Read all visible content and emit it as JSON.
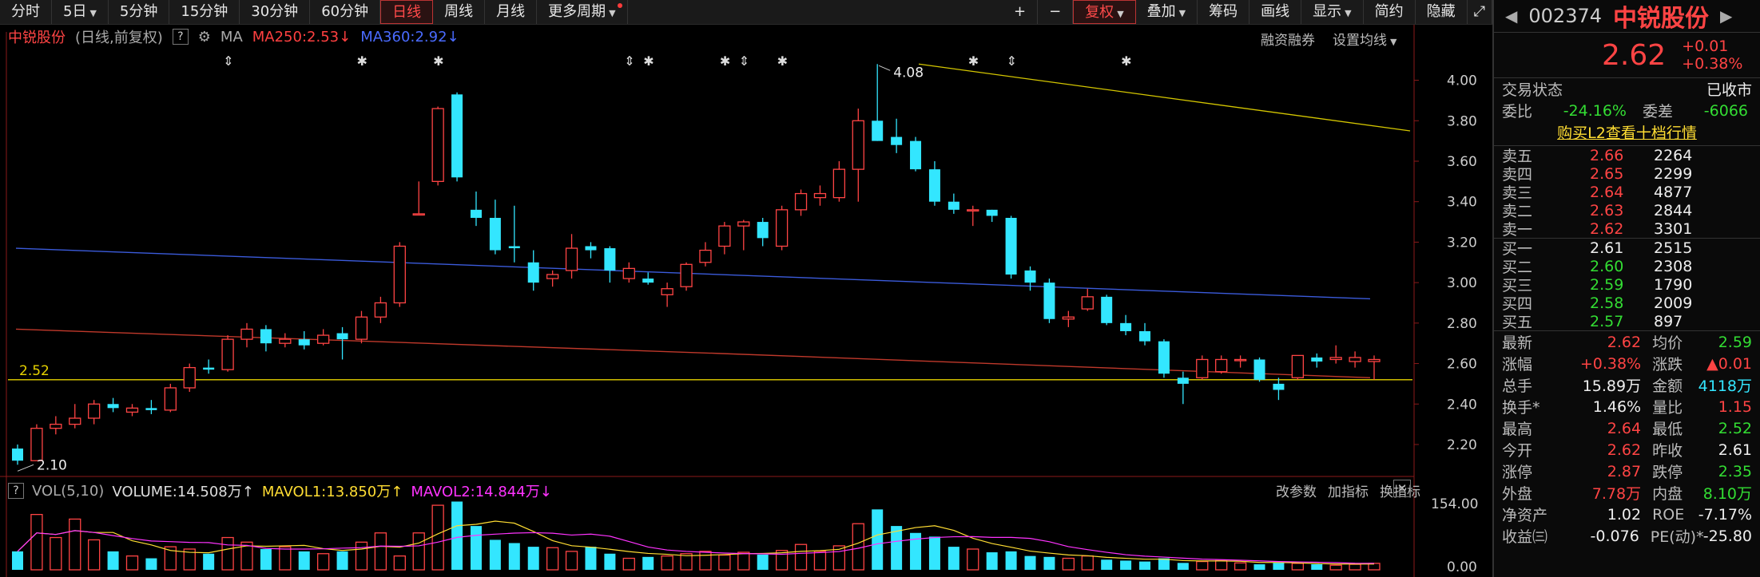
{
  "toolbar": {
    "periods": [
      "分时",
      "5日",
      "5分钟",
      "15分钟",
      "30分钟",
      "60分钟",
      "日线",
      "周线",
      "月线",
      "更多周期"
    ],
    "active": "日线",
    "right": [
      "+",
      "−",
      "复权",
      "叠加",
      "筹码",
      "画线",
      "显示",
      "简约",
      "隐藏"
    ]
  },
  "header": {
    "stock_name": "中锐股份",
    "subtitle": "(日线,前复权)",
    "ma_label": "MA",
    "ma250": "MA250:2.53↓",
    "ma360": "MA360:2.92↓",
    "margin_btn": "融资融券",
    "set_ma_btn": "设置均线"
  },
  "price_axis": {
    "ticks": [
      "4.00",
      "3.80",
      "3.60",
      "3.40",
      "3.20",
      "3.00",
      "2.80",
      "2.60",
      "2.40",
      "2.20"
    ],
    "high_label": "4.08",
    "low_label": "2.10",
    "level_label": "2.52"
  },
  "volume": {
    "label": "VOL(5,10)",
    "volume": "VOLUME:14.508万↑",
    "mavol1": "MAVOL1:13.850万↑",
    "mavol2": "MAVOL2:14.844万↓",
    "tools": [
      "改参数",
      "加指标",
      "换指标"
    ],
    "ticks": [
      "154.00",
      "0.00"
    ]
  },
  "colors": {
    "up": "#ff4444",
    "down": "#33e6ff",
    "ma360": "#3b5bdb",
    "ma250": "#c0392b",
    "trend": "#d4c600",
    "level": "#e6d200"
  },
  "candles": [
    [
      2.18,
      2.12,
      2.2,
      2.1
    ],
    [
      2.12,
      2.28,
      2.3,
      2.12
    ],
    [
      2.28,
      2.3,
      2.34,
      2.25
    ],
    [
      2.3,
      2.33,
      2.4,
      2.28
    ],
    [
      2.33,
      2.4,
      2.42,
      2.3
    ],
    [
      2.4,
      2.38,
      2.43,
      2.36
    ],
    [
      2.36,
      2.38,
      2.4,
      2.34
    ],
    [
      2.38,
      2.37,
      2.42,
      2.35
    ],
    [
      2.37,
      2.48,
      2.5,
      2.36
    ],
    [
      2.48,
      2.58,
      2.6,
      2.46
    ],
    [
      2.58,
      2.57,
      2.62,
      2.55
    ],
    [
      2.57,
      2.72,
      2.74,
      2.56
    ],
    [
      2.72,
      2.77,
      2.8,
      2.68
    ],
    [
      2.77,
      2.7,
      2.79,
      2.66
    ],
    [
      2.7,
      2.72,
      2.75,
      2.68
    ],
    [
      2.72,
      2.69,
      2.76,
      2.67
    ],
    [
      2.7,
      2.74,
      2.77,
      2.69
    ],
    [
      2.75,
      2.72,
      2.78,
      2.62
    ],
    [
      2.72,
      2.83,
      2.86,
      2.7
    ],
    [
      2.83,
      2.9,
      2.93,
      2.8
    ],
    [
      2.9,
      3.18,
      3.2,
      2.88
    ],
    [
      3.34,
      3.34,
      3.5,
      3.34
    ],
    [
      3.5,
      3.86,
      3.87,
      3.48
    ],
    [
      3.93,
      3.52,
      3.94,
      3.5
    ],
    [
      3.36,
      3.32,
      3.45,
      3.28
    ],
    [
      3.32,
      3.16,
      3.41,
      3.14
    ],
    [
      3.18,
      3.17,
      3.38,
      3.1
    ],
    [
      3.1,
      3.0,
      3.16,
      2.96
    ],
    [
      3.02,
      3.04,
      3.06,
      2.98
    ],
    [
      3.06,
      3.17,
      3.24,
      3.02
    ],
    [
      3.18,
      3.16,
      3.2,
      3.12
    ],
    [
      3.17,
      3.06,
      3.18,
      3.0
    ],
    [
      3.02,
      3.07,
      3.1,
      3.0
    ],
    [
      3.02,
      3.0,
      3.05,
      2.99
    ],
    [
      2.94,
      2.97,
      3.0,
      2.88
    ],
    [
      2.98,
      3.09,
      3.1,
      2.96
    ],
    [
      3.1,
      3.16,
      3.2,
      3.08
    ],
    [
      3.18,
      3.28,
      3.3,
      3.14
    ],
    [
      3.28,
      3.3,
      3.31,
      3.16
    ],
    [
      3.3,
      3.22,
      3.32,
      3.18
    ],
    [
      3.18,
      3.36,
      3.38,
      3.16
    ],
    [
      3.36,
      3.44,
      3.46,
      3.33
    ],
    [
      3.42,
      3.44,
      3.48,
      3.38
    ],
    [
      3.42,
      3.56,
      3.6,
      3.4
    ],
    [
      3.56,
      3.8,
      3.86,
      3.4
    ],
    [
      3.8,
      3.7,
      4.08,
      3.7
    ],
    [
      3.72,
      3.68,
      3.81,
      3.64
    ],
    [
      3.7,
      3.56,
      3.72,
      3.55
    ],
    [
      3.56,
      3.4,
      3.6,
      3.38
    ],
    [
      3.4,
      3.36,
      3.44,
      3.34
    ],
    [
      3.36,
      3.36,
      3.38,
      3.28
    ],
    [
      3.36,
      3.33,
      3.36,
      3.3
    ],
    [
      3.32,
      3.04,
      3.33,
      3.02
    ],
    [
      3.06,
      3.0,
      3.08,
      2.96
    ],
    [
      3.0,
      2.82,
      3.02,
      2.8
    ],
    [
      2.82,
      2.83,
      2.86,
      2.78
    ],
    [
      2.87,
      2.93,
      2.97,
      2.86
    ],
    [
      2.93,
      2.8,
      2.94,
      2.79
    ],
    [
      2.8,
      2.76,
      2.84,
      2.74
    ],
    [
      2.76,
      2.71,
      2.8,
      2.69
    ],
    [
      2.71,
      2.55,
      2.72,
      2.53
    ],
    [
      2.53,
      2.5,
      2.56,
      2.4
    ],
    [
      2.53,
      2.62,
      2.64,
      2.52
    ],
    [
      2.56,
      2.62,
      2.64,
      2.55
    ],
    [
      2.62,
      2.62,
      2.64,
      2.58
    ],
    [
      2.62,
      2.52,
      2.63,
      2.51
    ],
    [
      2.5,
      2.47,
      2.53,
      2.42
    ],
    [
      2.53,
      2.64,
      2.64,
      2.52
    ],
    [
      2.63,
      2.61,
      2.65,
      2.58
    ],
    [
      2.62,
      2.63,
      2.69,
      2.6
    ],
    [
      2.61,
      2.63,
      2.66,
      2.58
    ],
    [
      2.61,
      2.62,
      2.64,
      2.52
    ]
  ],
  "volumes": [
    40,
    120,
    70,
    110,
    65,
    40,
    30,
    25,
    50,
    45,
    35,
    70,
    60,
    45,
    50,
    40,
    35,
    40,
    60,
    80,
    30,
    80,
    140,
    148,
    95,
    65,
    58,
    50,
    48,
    40,
    50,
    35,
    25,
    28,
    30,
    35,
    40,
    32,
    38,
    33,
    42,
    55,
    40,
    52,
    100,
    131,
    95,
    80,
    72,
    50,
    45,
    38,
    40,
    30,
    28,
    25,
    30,
    22,
    20,
    18,
    25,
    15,
    18,
    20,
    15,
    12,
    15,
    14,
    12,
    10,
    12,
    14
  ],
  "right_panel": {
    "code": "002374",
    "name": "中锐股份",
    "price": "2.62",
    "change": "+0.01",
    "change_pct": "+0.38%",
    "status_label": "交易状态",
    "status": "已收市",
    "webi_label": "委比",
    "webi": "-24.16%",
    "weicha_label": "委差",
    "weicha": "-6066",
    "l2_link": "购买L2查看十档行情",
    "asks": [
      {
        "label": "卖五",
        "price": "2.66",
        "vol": "2264"
      },
      {
        "label": "卖四",
        "price": "2.65",
        "vol": "2299"
      },
      {
        "label": "卖三",
        "price": "2.64",
        "vol": "4877"
      },
      {
        "label": "卖二",
        "price": "2.63",
        "vol": "2844"
      },
      {
        "label": "卖一",
        "price": "2.62",
        "vol": "3301"
      }
    ],
    "bids": [
      {
        "label": "买一",
        "price": "2.61",
        "vol": "2515"
      },
      {
        "label": "买二",
        "price": "2.60",
        "vol": "2308"
      },
      {
        "label": "买三",
        "price": "2.59",
        "vol": "1790"
      },
      {
        "label": "买四",
        "price": "2.58",
        "vol": "2009"
      },
      {
        "label": "买五",
        "price": "2.57",
        "vol": "897"
      }
    ],
    "stats": [
      [
        "最新",
        "2.62",
        "均价",
        "2.59"
      ],
      [
        "涨幅",
        "+0.38%",
        "涨跌",
        "▲0.01"
      ],
      [
        "总手",
        "15.89万",
        "金额",
        "4118万"
      ],
      [
        "换手*",
        "1.46%",
        "量比",
        "1.15"
      ],
      [
        "最高",
        "2.64",
        "最低",
        "2.52"
      ],
      [
        "今开",
        "2.62",
        "昨收",
        "2.61"
      ],
      [
        "涨停",
        "2.87",
        "跌停",
        "2.35"
      ],
      [
        "外盘",
        "7.78万",
        "内盘",
        "8.10万"
      ],
      [
        "净资产",
        "1.02",
        "ROE",
        "-7.17%"
      ],
      [
        "收益㈢",
        "-0.076",
        "PE(动)*",
        "-25.80"
      ]
    ]
  }
}
